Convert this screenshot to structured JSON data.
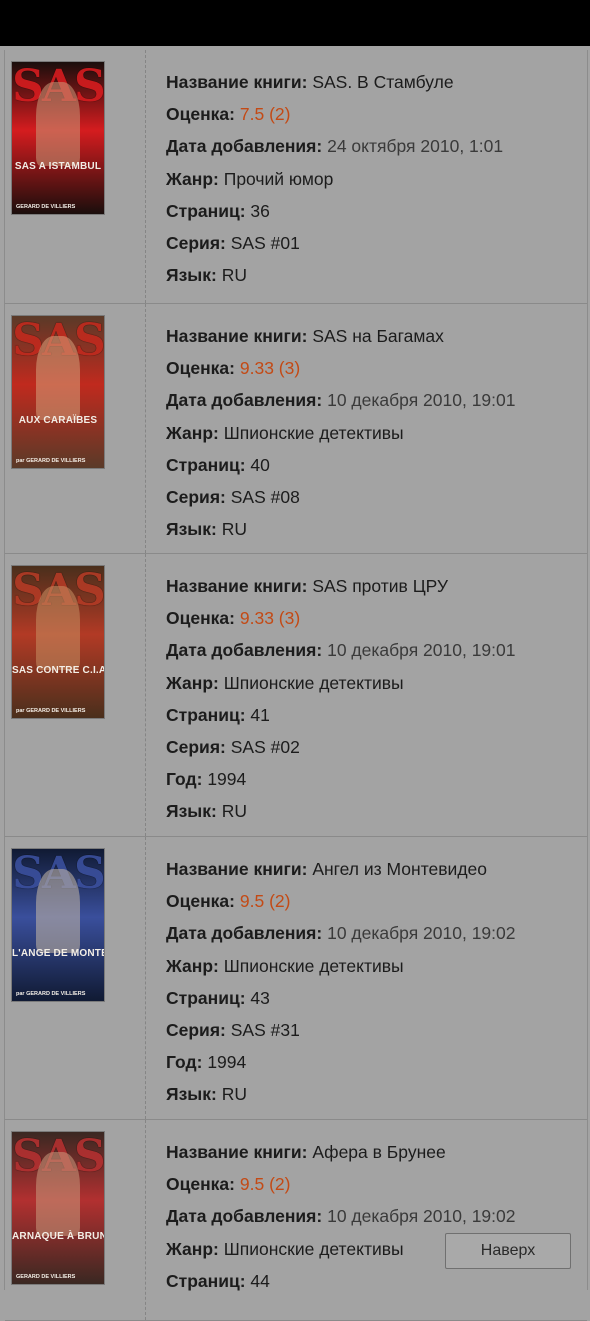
{
  "labels": {
    "name": "Название книги:",
    "rating": "Оценка:",
    "date": "Дата добавления:",
    "genre": "Жанр:",
    "pages": "Страниц:",
    "series": "Серия:",
    "year": "Год:",
    "language": "Язык:"
  },
  "books": [
    {
      "name": "SAS. В Стамбуле",
      "rating": "7.5 (2)",
      "date": "24 октября 2010, 1:01",
      "genre": "Прочий юмор",
      "pages": "36",
      "series": "SAS #01",
      "year": null,
      "language": "RU",
      "cover": {
        "title": "SAS A ISTAMBUL",
        "author": "GERARD DE VILLIERS",
        "bg": "#1a0e0c",
        "accent": "#d51c1f",
        "text": "#f1ede6",
        "figure": "#c79a7a"
      }
    },
    {
      "name": "SAS на Багамах",
      "rating": "9.33 (3)",
      "date": "10 декабря 2010, 19:01",
      "genre": "Шпионские детективы",
      "pages": "40",
      "series": "SAS #08",
      "year": null,
      "language": "RU",
      "cover": {
        "title": "AUX CARAÏBES",
        "author": "par GERARD DE VILLIERS",
        "bg": "#5a3a28",
        "accent": "#c02a1e",
        "text": "#f2ece4",
        "figure": "#d6a27c"
      }
    },
    {
      "name": "SAS против ЦРУ",
      "rating": "9.33 (3)",
      "date": "10 декабря 2010, 19:01",
      "genre": "Шпионские детективы",
      "pages": "41",
      "series": "SAS #02",
      "year": "1994",
      "language": "RU",
      "cover": {
        "title": "SAS CONTRE C.I.A",
        "author": "par GERARD DE VILLIERS",
        "bg": "#4a2f1c",
        "accent": "#b23a25",
        "text": "#f3eee6",
        "figure": "#c68f63"
      }
    },
    {
      "name": "Ангел из Монтевидео",
      "rating": "9.5 (2)",
      "date": "10 декабря 2010, 19:02",
      "genre": "Шпионские детективы",
      "pages": "43",
      "series": "SAS #31",
      "year": "1994",
      "language": "RU",
      "cover": {
        "title": "L'ANGE DE MONTEVIDEO",
        "author": "par GERARD DE VILLIERS",
        "bg": "#101a33",
        "accent": "#3a4f9c",
        "text": "#f3eee6",
        "figure": "#c9b9a6"
      }
    },
    {
      "name": "Афера в Брунее",
      "rating": "9.5 (2)",
      "date": "10 декабря 2010, 19:02",
      "genre": "Шпионские детективы",
      "pages": "44",
      "series": null,
      "year": null,
      "language": null,
      "cover": {
        "title": "ARNAQUE À BRUNEI",
        "author": "GERARD DE VILLIERS",
        "bg": "#3a2822",
        "accent": "#b23030",
        "text": "#f3eee6",
        "figure": "#c89b7d"
      }
    }
  ],
  "scroll_top_button": "Наверх"
}
